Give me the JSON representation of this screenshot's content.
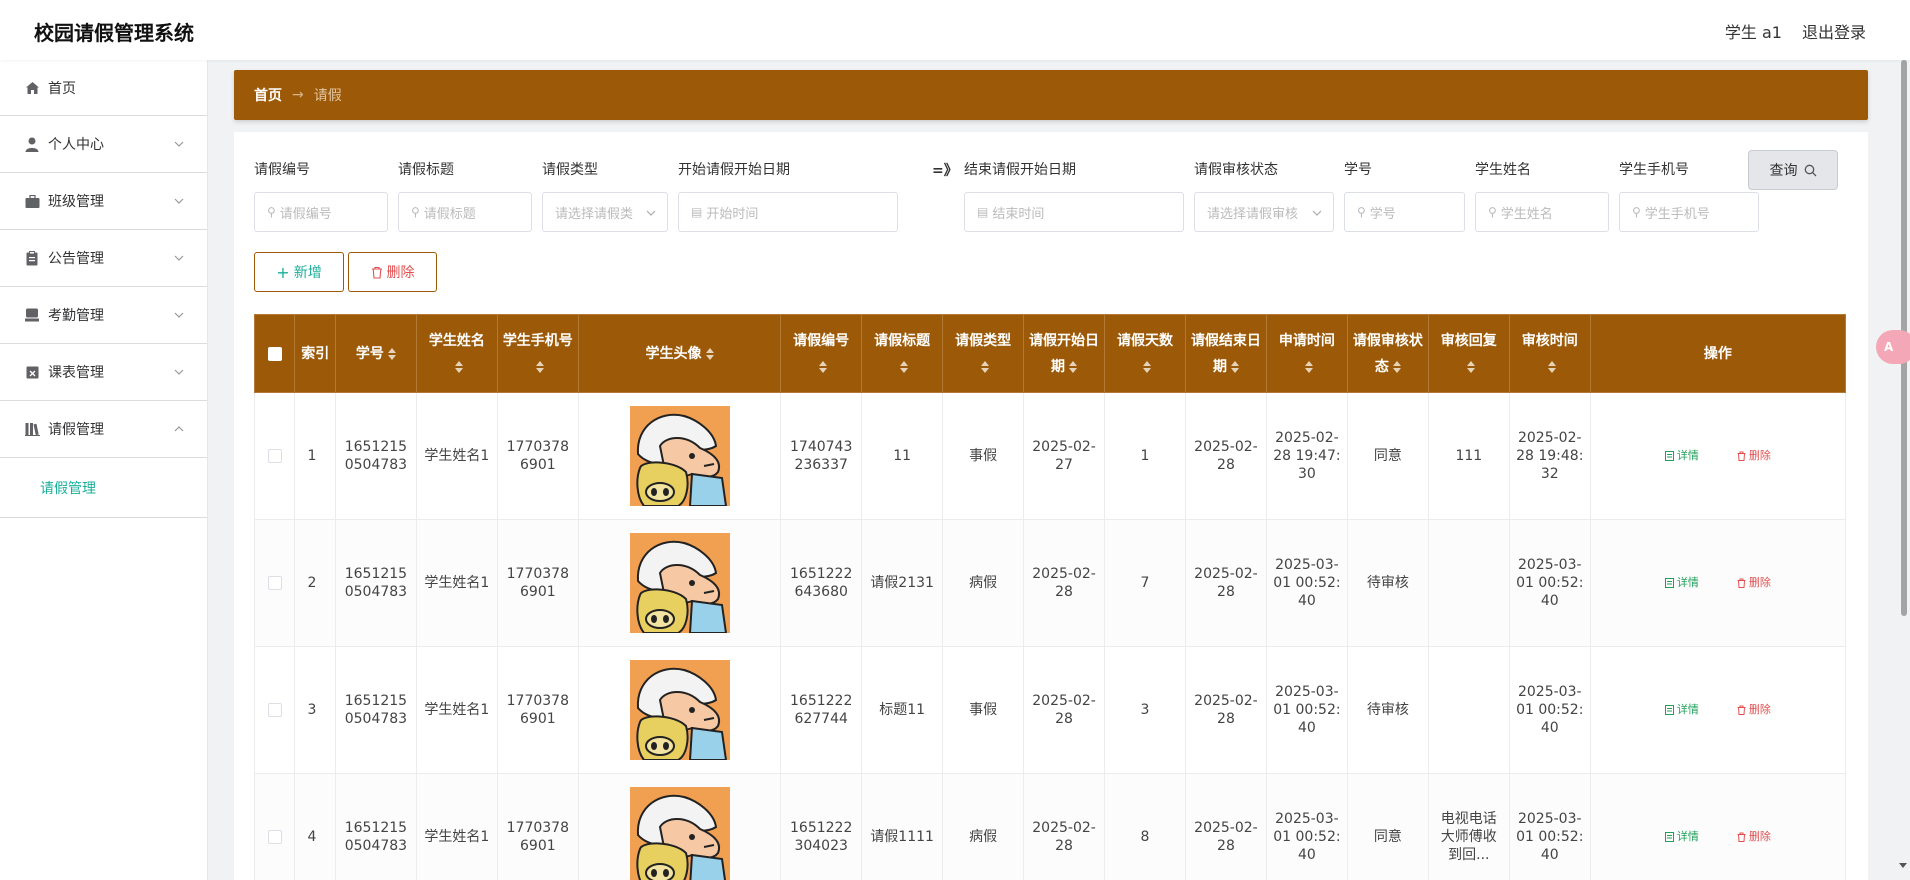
{
  "app": {
    "title": "校园请假管理系统"
  },
  "header": {
    "user": "学生 a1",
    "logout": "退出登录"
  },
  "sidebar": {
    "items": [
      {
        "label": "首页",
        "icon": "home-icon"
      },
      {
        "label": "个人中心",
        "icon": "user-icon"
      },
      {
        "label": "班级管理",
        "icon": "briefcase-icon"
      },
      {
        "label": "公告管理",
        "icon": "clipboard-icon"
      },
      {
        "label": "考勤管理",
        "icon": "stamp-icon"
      },
      {
        "label": "课表管理",
        "icon": "calendar-x-icon"
      },
      {
        "label": "请假管理",
        "icon": "library-icon"
      }
    ],
    "sub_active": "请假管理"
  },
  "breadcrumb": {
    "home": "首页",
    "sep": "→",
    "current": "请假"
  },
  "filters": {
    "leave_no": {
      "label": "请假编号",
      "placeholder": "请假编号"
    },
    "leave_title": {
      "label": "请假标题",
      "placeholder": "请假标题"
    },
    "leave_type": {
      "label": "请假类型",
      "placeholder": "请选择请假类"
    },
    "start_from": {
      "label": "开始请假开始日期",
      "placeholder": "开始时间"
    },
    "range_sep": "=》",
    "start_to": {
      "label": "结束请假开始日期",
      "placeholder": "结束时间"
    },
    "audit_status": {
      "label": "请假审核状态",
      "placeholder": "请选择请假审核"
    },
    "student_no": {
      "label": "学号",
      "placeholder": "学号"
    },
    "student_name": {
      "label": "学生姓名",
      "placeholder": "学生姓名"
    },
    "student_phone": {
      "label": "学生手机号",
      "placeholder": "学生手机号"
    },
    "query": "查询"
  },
  "actions": {
    "add": "新增",
    "delete": "删除"
  },
  "table": {
    "headers": [
      "索引",
      "学号",
      "学生姓名",
      "学生手机号",
      "学生头像",
      "请假编号",
      "请假标题",
      "请假类型",
      "请假开始日期",
      "请假天数",
      "请假结束日期",
      "申请时间",
      "请假审核状态",
      "审核回复",
      "审核时间",
      "操作"
    ],
    "rows": [
      {
        "index": "1",
        "student_no": "16512150504783",
        "name": "学生姓名1",
        "phone": "17703786901",
        "leave_no": "1740743236337",
        "title": "11",
        "type": "事假",
        "start": "2025-02-27",
        "days": "1",
        "end": "2025-02-28",
        "apply_time": "2025-02-28 19:47:30",
        "status": "同意",
        "reply": "111",
        "audit_time": "2025-02-28 19:48:32"
      },
      {
        "index": "2",
        "student_no": "16512150504783",
        "name": "学生姓名1",
        "phone": "17703786901",
        "leave_no": "1651222643680",
        "title": "请假2131",
        "type": "病假",
        "start": "2025-02-28",
        "days": "7",
        "end": "2025-02-28",
        "apply_time": "2025-03-01 00:52:40",
        "status": "待审核",
        "reply": "",
        "audit_time": "2025-03-01 00:52:40"
      },
      {
        "index": "3",
        "student_no": "16512150504783",
        "name": "学生姓名1",
        "phone": "17703786901",
        "leave_no": "1651222627744",
        "title": "标题11",
        "type": "事假",
        "start": "2025-02-28",
        "days": "3",
        "end": "2025-02-28",
        "apply_time": "2025-03-01 00:52:40",
        "status": "待审核",
        "reply": "",
        "audit_time": "2025-03-01 00:52:40"
      },
      {
        "index": "4",
        "student_no": "16512150504783",
        "name": "学生姓名1",
        "phone": "17703786901",
        "leave_no": "1651222304023",
        "title": "请假1111",
        "type": "病假",
        "start": "2025-02-28",
        "days": "8",
        "end": "2025-02-28",
        "apply_time": "2025-03-01 00:52:40",
        "status": "同意",
        "reply": "电视电话大师傅收到回...",
        "audit_time": "2025-03-01 00:52:40"
      }
    ],
    "op_detail": "详情",
    "op_delete": "删除"
  },
  "float_button": "A",
  "colors": {
    "primary": "#9c5a08",
    "accent": "#1aaf9a",
    "danger": "#e05050",
    "success": "#22a05a"
  }
}
